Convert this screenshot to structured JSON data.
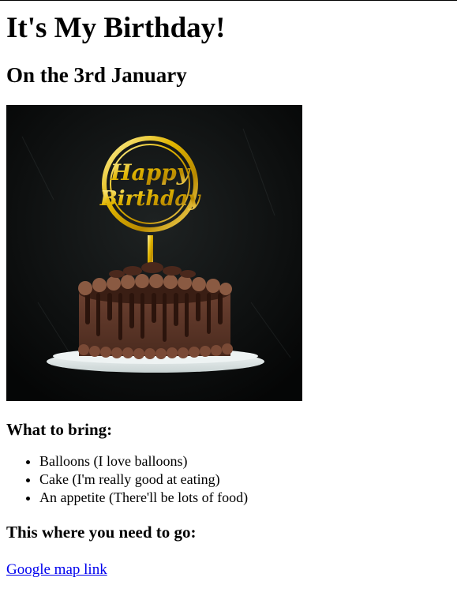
{
  "page": {
    "title": "It's My Birthday!",
    "date": "On the 3rd January"
  },
  "hero_image": {
    "alt": "Chocolate birthday cake with a gold Happy Birthday topper",
    "topper_line1": "Happy",
    "topper_line2": "Birthday"
  },
  "bring": {
    "heading": "What to bring:",
    "items": [
      "Balloons (I love balloons)",
      "Cake (I'm really good at eating)",
      "An appetite (There'll be lots of food)"
    ]
  },
  "location": {
    "heading": "This where you need to go:",
    "link_label": "Google map link"
  }
}
